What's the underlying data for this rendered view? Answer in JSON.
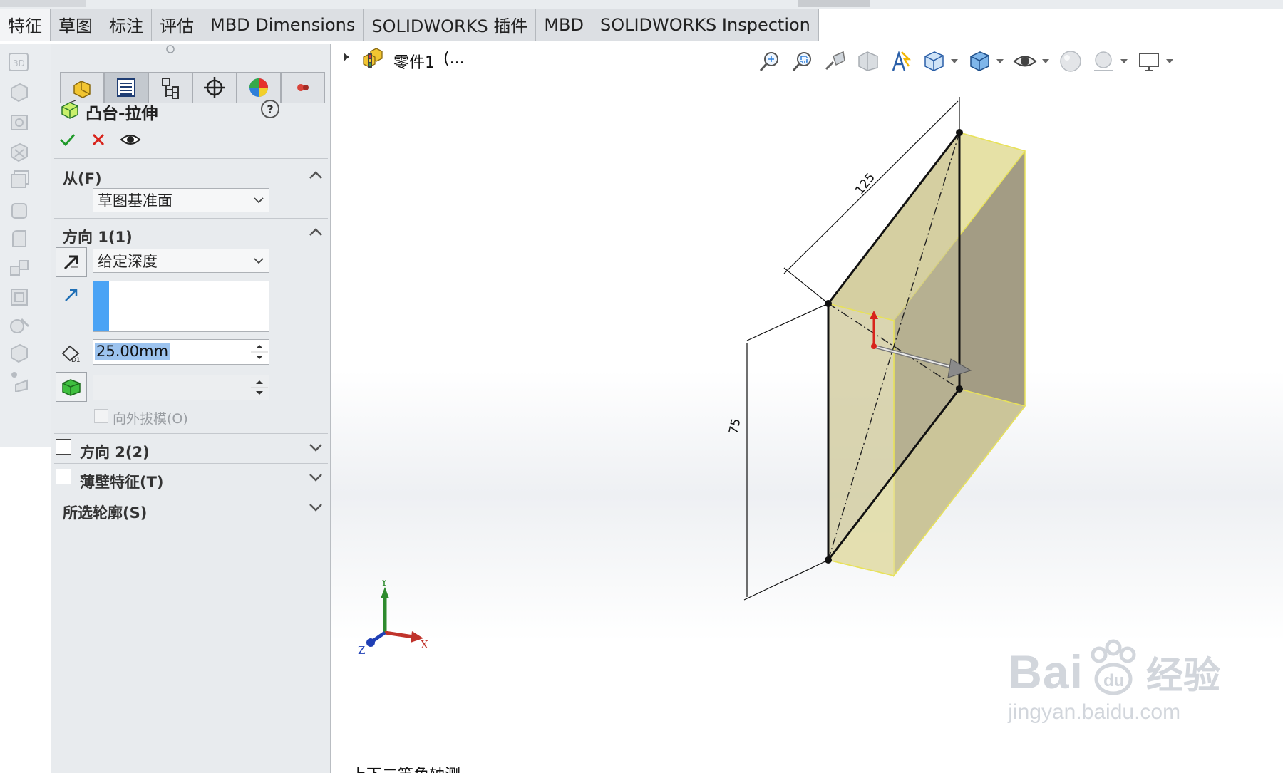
{
  "tabs": [
    {
      "label": "特征",
      "active": true
    },
    {
      "label": "草图",
      "active": false
    },
    {
      "label": "标注",
      "active": false
    },
    {
      "label": "评估",
      "active": false
    },
    {
      "label": "MBD Dimensions",
      "active": false
    },
    {
      "label": "SOLIDWORKS 插件",
      "active": false
    },
    {
      "label": "MBD",
      "active": false
    },
    {
      "label": "SOLIDWORKS Inspection",
      "active": false
    }
  ],
  "feature_tree": {
    "part_label": "零件1",
    "suffix": "(..."
  },
  "property_manager": {
    "title": "凸台-拉伸",
    "help": "?",
    "from_section": {
      "title": "从(F)",
      "value": "草图基准面"
    },
    "direction1": {
      "title": "方向 1(1)",
      "end_condition": "给定深度",
      "depth": "25.00mm",
      "draft_outward_label": "向外拔模(O)"
    },
    "direction2": {
      "title": "方向 2(2)",
      "checked": false
    },
    "thin_feature": {
      "title": "薄壁特征(T)",
      "checked": false
    },
    "selected_contours": {
      "title": "所选轮廓(S)"
    }
  },
  "sketch": {
    "dim_horizontal": "125",
    "dim_vertical": "75"
  },
  "triad": {
    "x": "X",
    "y": "Y",
    "z": "Z"
  },
  "bottom_text": "上下二等角轴测",
  "watermark": {
    "brand": "Bai",
    "brand_cn": "经验",
    "url": "jingyan.baidu.com"
  },
  "colors": {
    "accent_blue": "#4aa3f5",
    "selection_highlight": "#9cc3ef",
    "face_yellow": "#f3f0b8",
    "confirm_green": "#1f9a2a",
    "cancel_red": "#d8241c"
  }
}
